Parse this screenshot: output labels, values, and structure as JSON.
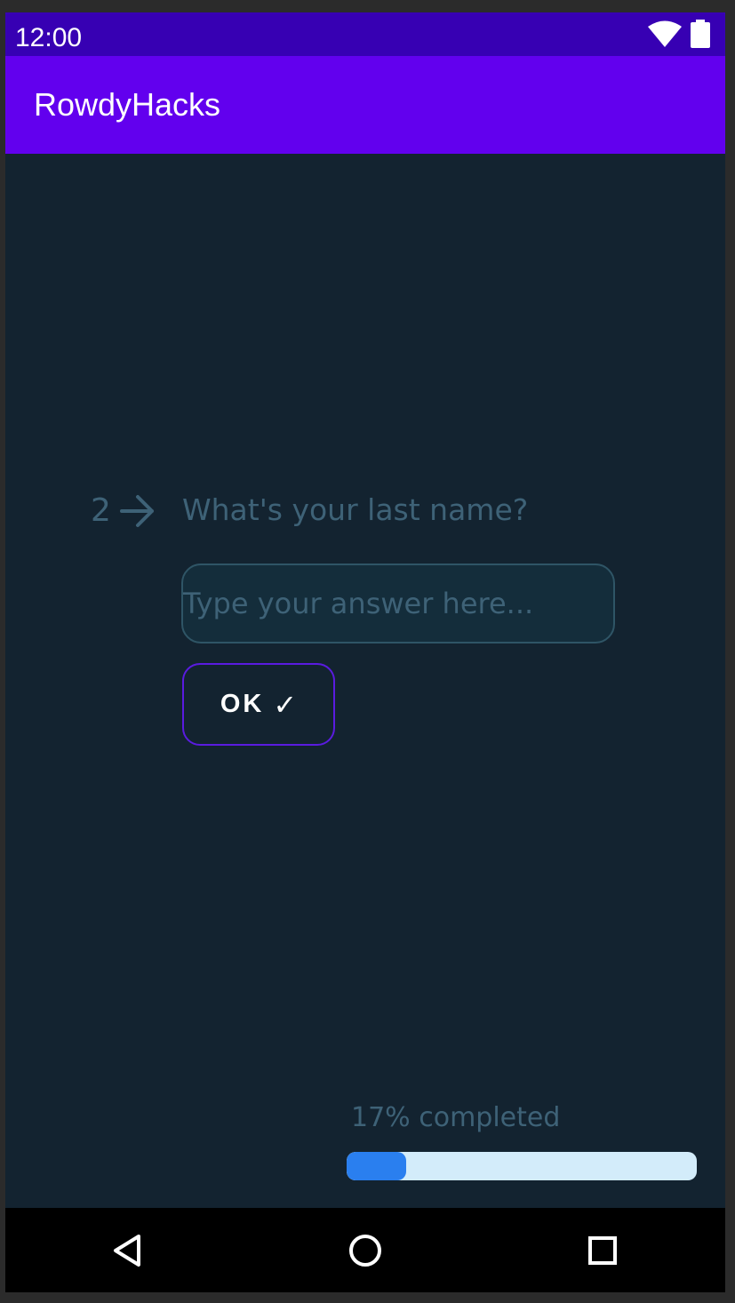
{
  "status_bar": {
    "time": "12:00",
    "icons": [
      "wifi-icon",
      "battery-icon"
    ]
  },
  "app_bar": {
    "title": "RowdyHacks"
  },
  "question": {
    "number": "2",
    "arrow_icon": "arrow-right-icon",
    "text": "What's your last name?"
  },
  "answer": {
    "placeholder": "Type your answer here...",
    "value": ""
  },
  "ok_button": {
    "label": "OK",
    "check": "✓"
  },
  "progress": {
    "label": "17% completed",
    "percent": 17
  },
  "nav_bar": {
    "icons": [
      "back-icon",
      "home-icon",
      "recents-icon"
    ]
  },
  "colors": {
    "status_bar": "#3700b3",
    "app_bar": "#6200ee",
    "background": "#132330",
    "muted_text": "#3e6277",
    "button_border": "#5a1be0",
    "progress_track": "#d3ecfa",
    "progress_fill": "#2a7fef"
  }
}
